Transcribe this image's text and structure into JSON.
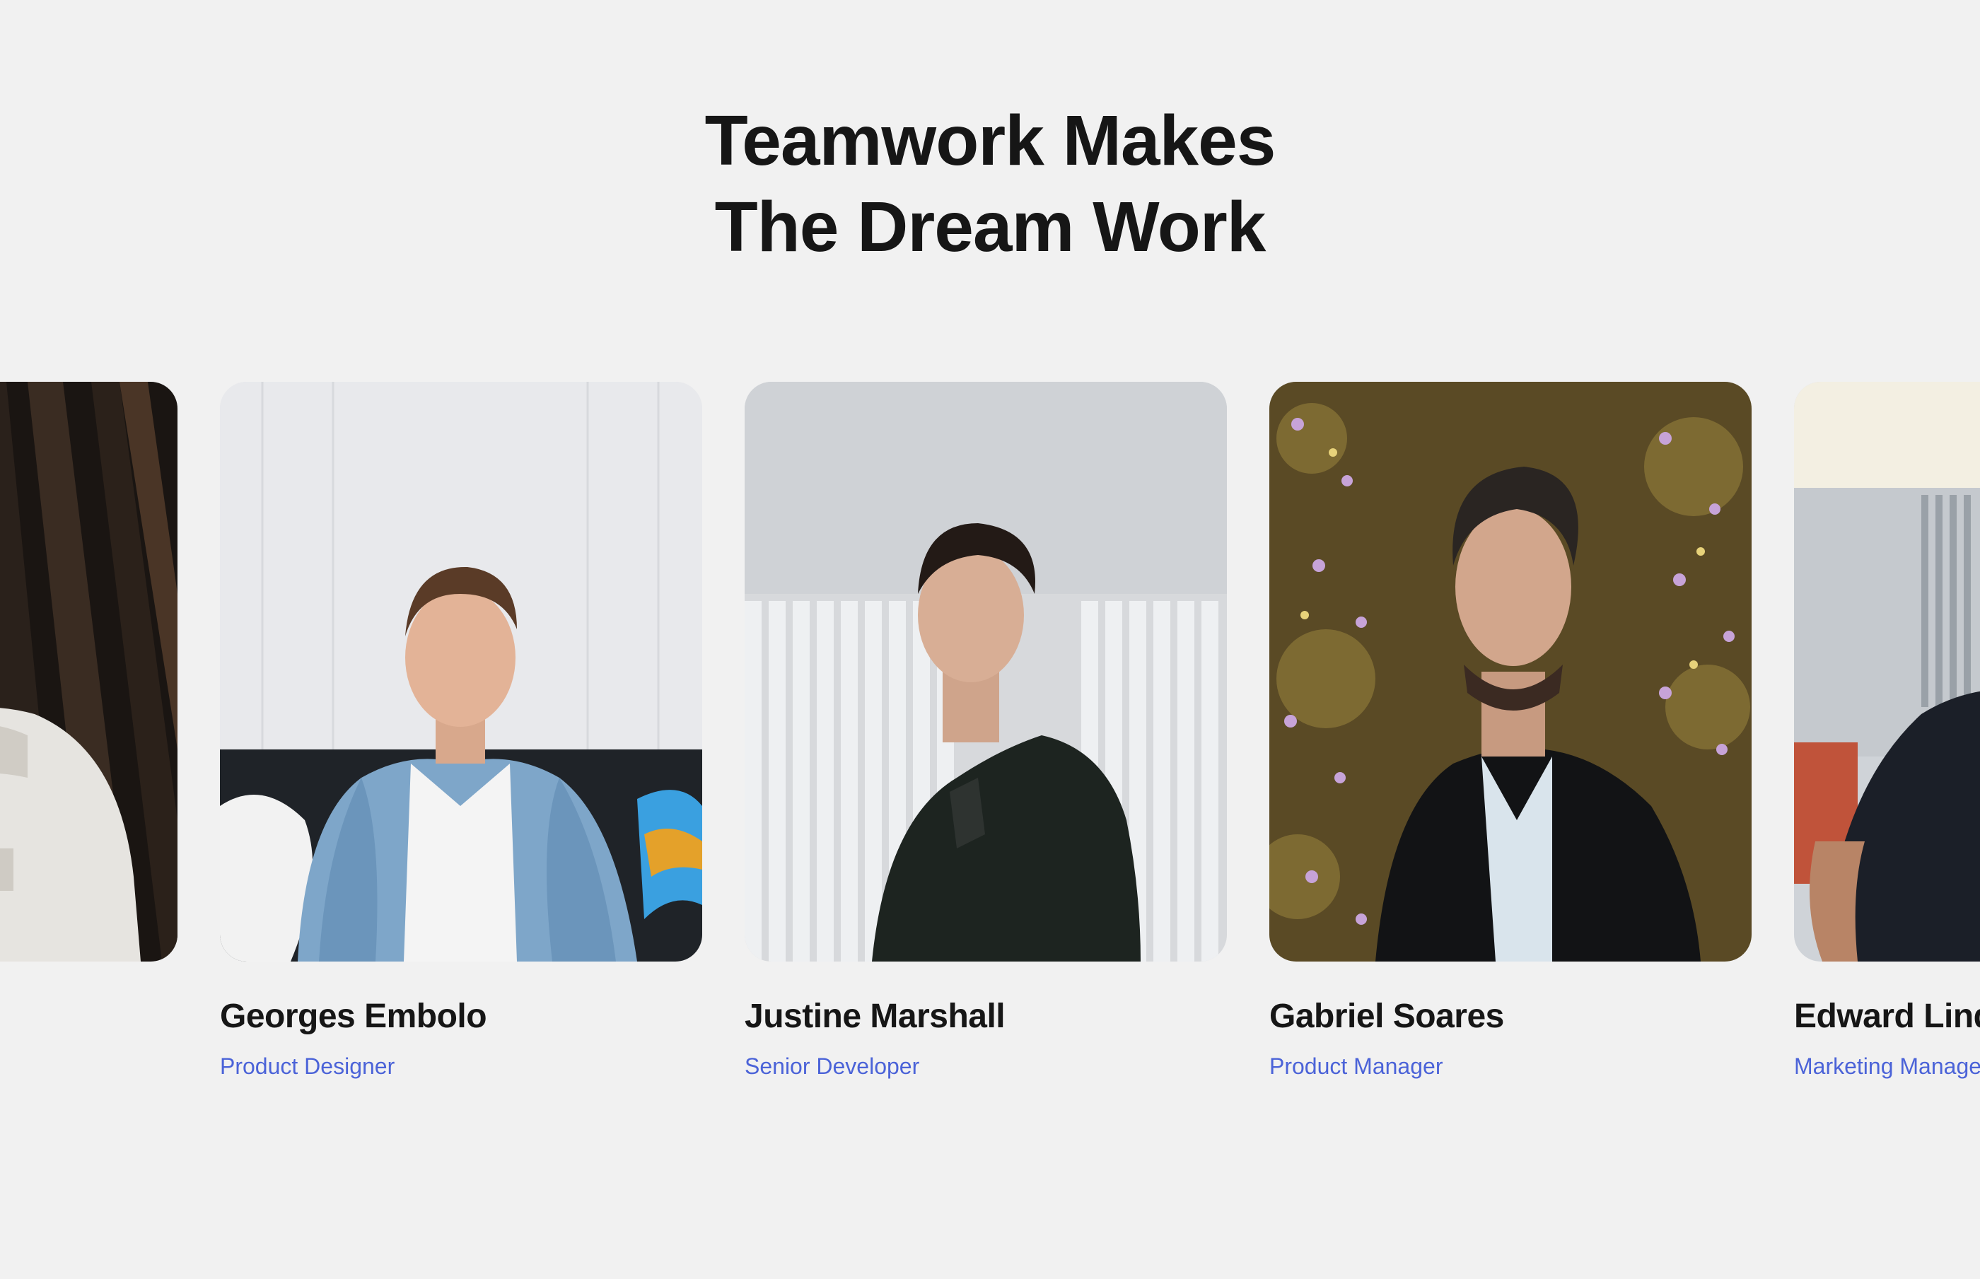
{
  "section": {
    "title_line1": "Teamwork Makes",
    "title_line2": "The Dream Work"
  },
  "team": [
    {
      "name": "",
      "role": ""
    },
    {
      "name": "Georges Embolo",
      "role": "Product Designer"
    },
    {
      "name": "Justine Marshall",
      "role": "Senior Developer"
    },
    {
      "name": "Gabriel Soares",
      "role": "Product Manager"
    },
    {
      "name": "Edward Lind",
      "role": "Marketing Manager"
    }
  ],
  "colors": {
    "background": "#f1f1f1",
    "heading": "#161616",
    "role_accent": "#4b63d8"
  }
}
